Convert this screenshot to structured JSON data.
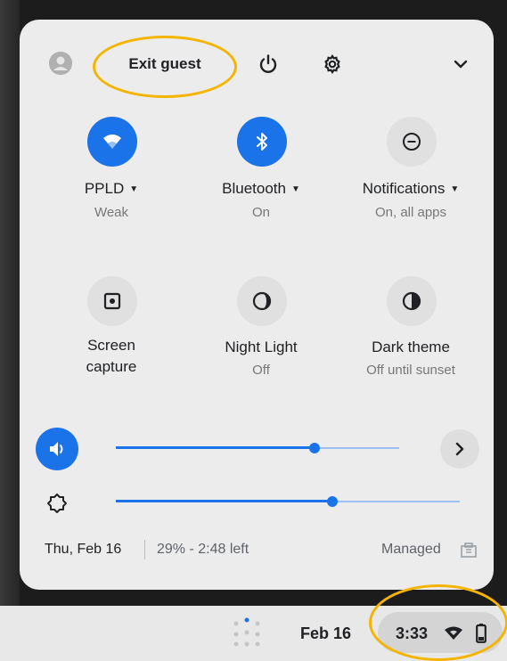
{
  "header": {
    "exit_guest_label": "Exit guest"
  },
  "tiles": [
    {
      "label": "PPLD",
      "sub": "Weak",
      "icon": "wifi-icon",
      "active": true,
      "has_menu": true
    },
    {
      "label": "Bluetooth",
      "sub": "On",
      "icon": "bluetooth-icon",
      "active": true,
      "has_menu": true
    },
    {
      "label": "Notifications",
      "sub": "On, all apps",
      "icon": "notifications-icon",
      "active": false,
      "has_menu": true
    },
    {
      "label": "Screen\ncapture",
      "sub": "",
      "icon": "screen-capture-icon",
      "active": false,
      "has_menu": false
    },
    {
      "label": "Night Light",
      "sub": "Off",
      "icon": "night-light-icon",
      "active": false,
      "has_menu": false
    },
    {
      "label": "Dark theme",
      "sub": "Off until sunset",
      "icon": "dark-theme-icon",
      "active": false,
      "has_menu": false
    }
  ],
  "sliders": {
    "volume_level": 0.7,
    "brightness_level": 0.63
  },
  "footer": {
    "date": "Thu, Feb 16",
    "battery": "29% - 2:48 left",
    "managed": "Managed"
  },
  "shelf": {
    "date": "Feb 16",
    "time": "3:33"
  },
  "colors": {
    "accent": "#1a73e8",
    "highlight_ring": "#f4b400",
    "panel_bg": "#ececec"
  }
}
